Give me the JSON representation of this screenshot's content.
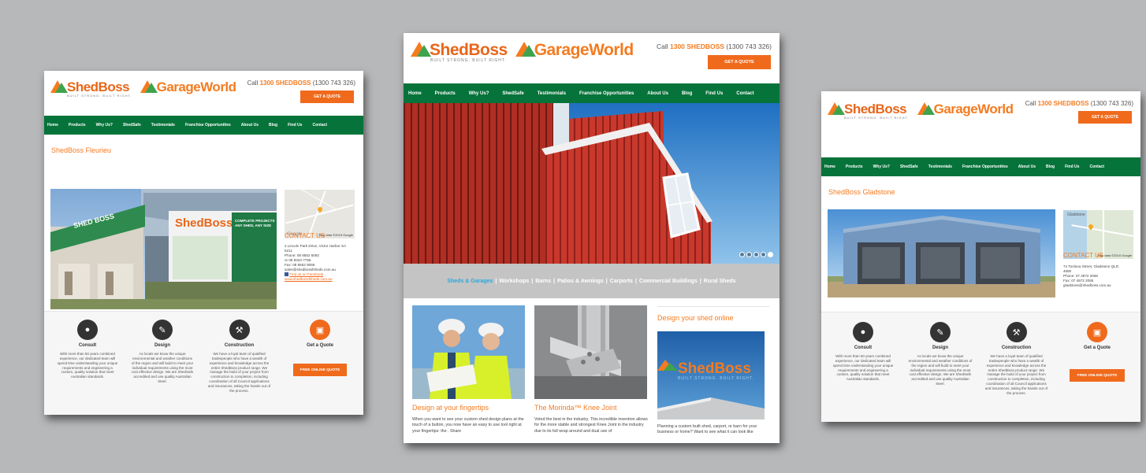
{
  "brand": {
    "shedboss": "ShedBoss",
    "tagline": "BUILT STRONG. BUILT RIGHT.",
    "garageworld": "GarageWorld",
    "call_prefix": "Call ",
    "call_highlight": "1300 SHEDBOSS",
    "call_suffix": " (1300 743 326)",
    "quote_button": "GET A QUOTE"
  },
  "nav": [
    "Home",
    "Products",
    "Why Us?",
    "ShedSafe",
    "Testimonials",
    "Franchise Opportunities",
    "About Us",
    "Blog",
    "Find Us",
    "Contact"
  ],
  "left": {
    "title": "ShedBoss Fleurieu",
    "map_attr": "Map data ©2015 Google",
    "contact_heading": "CONTACT US",
    "contact": [
      "2 Lincoln Park Drive, Victor Harbor SA",
      "5211",
      "Phone: 08 8552 6092",
      "or 08 8323 7756",
      "Fax: 08 8552 9066",
      "sales@shedbossfsheds.com.au"
    ],
    "facebook": "Find us on Facebook",
    "website": "www.shedbossfsheds.com.au",
    "banner_sign": "COMPLETE PROJECTS ANY SHED, ANY SIZE"
  },
  "right": {
    "title": "ShedBoss Gladstone",
    "map_attr": "Map data ©2015 Google",
    "map_place": "Gladstone",
    "contact_heading": "CONTACT US",
    "contact": [
      "74 Toolooa Street, Gladstone QLD",
      "4680",
      "Phone: 07 4972 2065",
      "Fax: 07 4972 2065",
      "gladstone@shedboss.com.au"
    ]
  },
  "features": [
    {
      "title": "Consult",
      "desc": "With more than 50 years combined experience, our dedicated team will spend time understanding your unique requirements and engineering a custom, quality solution that meet Australian standards."
    },
    {
      "title": "Design",
      "desc": "As locals we know the unique environmental and weather conditions of the region and will build to meet your individual requirements using the most cost effective design. We are ShedSafe accredited and use quality Australian Steel."
    },
    {
      "title": "Construction",
      "desc": "We have a loyal team of qualified tradespeople who have a wealth of experience and knowledge across the entire ShedBoss product range. We manage the build of your project from construction to completion, including coordination of all Council applications and insurances, taking the hassle out of the process."
    },
    {
      "title": "Get a Quote",
      "button": "FREE ONLINE QUOTE"
    }
  ],
  "mid": {
    "links": [
      "Sheds & Garages",
      "Workshops",
      "Barns",
      "Patios & Awnings",
      "Carports",
      "Commercial Buildings",
      "Rural Sheds"
    ],
    "columns": [
      {
        "title": "Design at your fingertips",
        "text": "When you want to see your custom shed design plans at the touch of a button, you now have an easy to use tool right at your fingertips: the                         . Share"
      },
      {
        "title": "The Morinda™ Knee Joint",
        "text": "Voted the best in the industry. This incredible invention allows for the more stable and strongest Knee Joint in the industry due to its full wrap around and dual use of"
      },
      {
        "title": "Design your shed online",
        "text": "Planning a custom built shed, carport, or barn for your business or home? Want to see what it can look like"
      }
    ]
  }
}
